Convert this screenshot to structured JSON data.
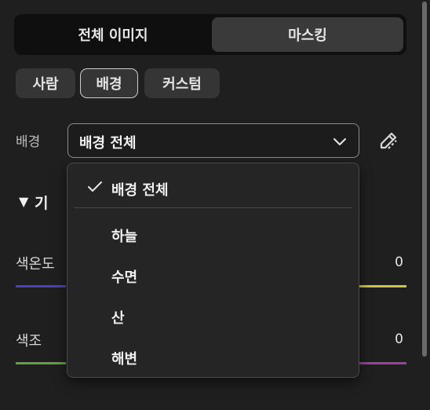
{
  "tabs": {
    "whole_image": "전체 이미지",
    "masking": "마스킹"
  },
  "chips": [
    "사람",
    "배경",
    "커스텀"
  ],
  "background_select": {
    "label": "배경",
    "value": "배경 전체"
  },
  "section": {
    "title": "기"
  },
  "sliders": [
    {
      "label": "색온도",
      "value": "0"
    },
    {
      "label": "색조",
      "value": "0"
    }
  ],
  "dropdown": {
    "selected": "배경 전체",
    "options": [
      "하늘",
      "수면",
      "산",
      "해변"
    ]
  },
  "icons": {
    "chevron": "chevron-down-icon",
    "edit": "edit-icon",
    "check": "check-icon",
    "triangle": "triangle-down-icon"
  },
  "colors": {
    "temp_left": "#4b3fc2",
    "temp_right": "#cfc43a",
    "tint_left": "#5aa63a",
    "tint_right": "#a43aa8"
  }
}
